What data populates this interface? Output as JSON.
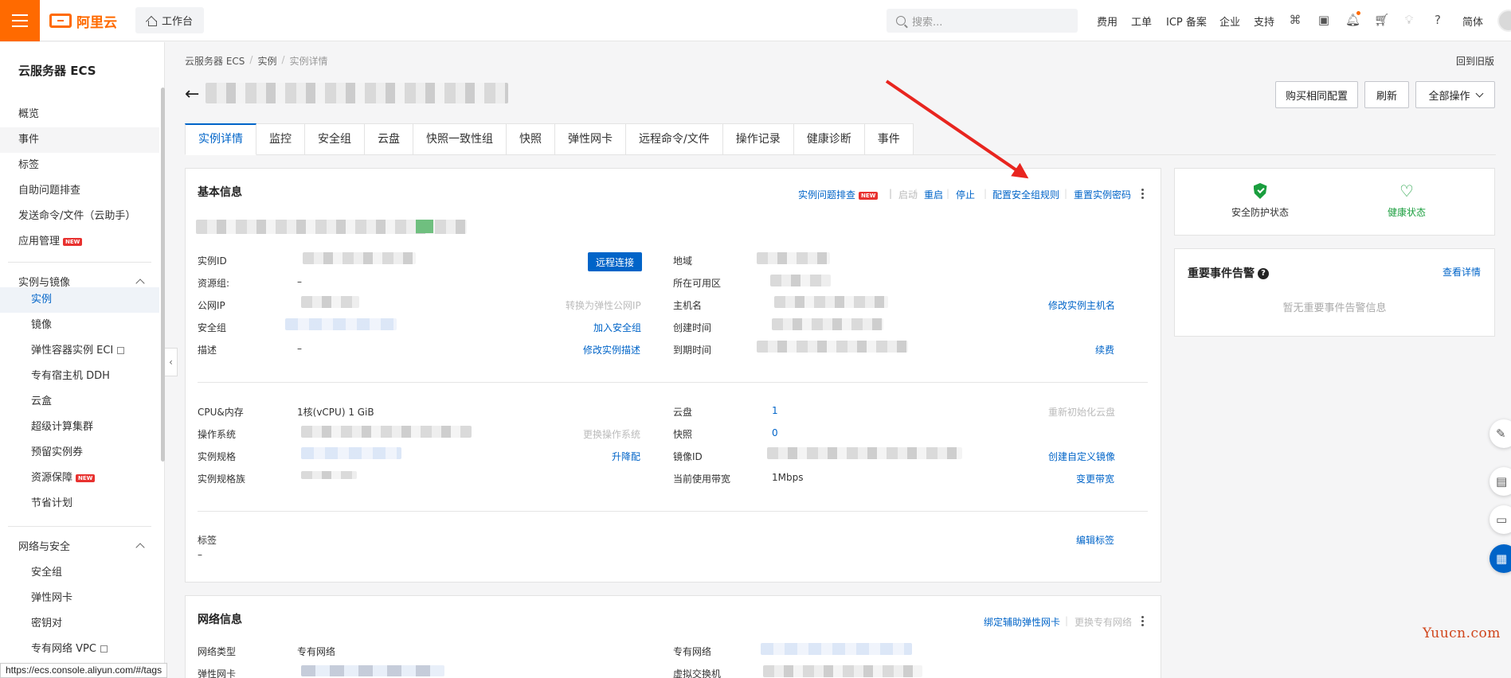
{
  "topbar": {
    "logo_text": "阿里云",
    "workbench": "工作台",
    "search_placeholder": "搜索...",
    "nav": [
      "费用",
      "工单",
      "ICP 备案",
      "企业",
      "支持"
    ],
    "language": "简体"
  },
  "sidebar": {
    "title": "云服务器 ECS",
    "top_items": [
      {
        "label": "概览"
      },
      {
        "label": "事件"
      },
      {
        "label": "标签"
      },
      {
        "label": "自助问题排查"
      },
      {
        "label": "发送命令/文件（云助手）"
      },
      {
        "label": "应用管理",
        "badge": "NEW"
      }
    ],
    "groups": [
      {
        "label": "实例与镜像",
        "items": [
          {
            "label": "实例",
            "active": true
          },
          {
            "label": "镜像"
          },
          {
            "label": "弹性容器实例 ECI",
            "external": true
          },
          {
            "label": "专有宿主机 DDH"
          },
          {
            "label": "云盒"
          },
          {
            "label": "超级计算集群"
          },
          {
            "label": "预留实例券"
          },
          {
            "label": "资源保障",
            "badge": "NEW"
          },
          {
            "label": "节省计划"
          }
        ]
      },
      {
        "label": "网络与安全",
        "items": [
          {
            "label": "安全组"
          },
          {
            "label": "弹性网卡"
          },
          {
            "label": "密钥对"
          },
          {
            "label": "专有网络 VPC",
            "external": true
          }
        ]
      }
    ]
  },
  "status_url": "https://ecs.console.aliyun.com/#/tags",
  "breadcrumb": [
    "云服务器 ECS",
    "实例",
    "实例详情"
  ],
  "back_to_old": "回到旧版",
  "header_buttons": {
    "buy_same": "购买相同配置",
    "refresh": "刷新",
    "all_actions": "全部操作"
  },
  "tabs": [
    "实例详情",
    "监控",
    "安全组",
    "云盘",
    "快照一致性组",
    "快照",
    "弹性网卡",
    "远程命令/文件",
    "操作记录",
    "健康诊断",
    "事件"
  ],
  "basic_info": {
    "title": "基本信息",
    "actions": {
      "troubleshoot": "实例问题排查",
      "troubleshoot_badge": "NEW",
      "start": "启动",
      "restart": "重启",
      "stop": "停止",
      "configure_sg": "配置安全组规则",
      "reset_password": "重置实例密码"
    },
    "left_rows": [
      {
        "label": "实例ID",
        "value": ""
      },
      {
        "label": "资源组:",
        "value": "–"
      },
      {
        "label": "公网IP",
        "value": ""
      },
      {
        "label": "安全组",
        "value": ""
      },
      {
        "label": "描述",
        "value": "–"
      }
    ],
    "left_actions": {
      "remote_connect": "远程连接",
      "convert_eip": "转换为弹性公网IP",
      "join_sg": "加入安全组",
      "edit_desc": "修改实例描述"
    },
    "right_rows": [
      {
        "label": "地域"
      },
      {
        "label": "所在可用区"
      },
      {
        "label": "主机名"
      },
      {
        "label": "创建时间"
      },
      {
        "label": "到期时间"
      }
    ],
    "right_actions": {
      "edit_hostname": "修改实例主机名",
      "renew": "续费"
    },
    "config_left": [
      {
        "label": "CPU&内存",
        "value": "1核(vCPU) 1 GiB"
      },
      {
        "label": "操作系统",
        "value": ""
      },
      {
        "label": "实例规格",
        "value": ""
      },
      {
        "label": "实例规格族",
        "value": ""
      }
    ],
    "config_left_actions": {
      "change_os": "更换操作系统",
      "upgrade": "升降配"
    },
    "config_right": [
      {
        "label": "云盘",
        "value": "1"
      },
      {
        "label": "快照",
        "value": "0"
      },
      {
        "label": "镜像ID",
        "value": ""
      },
      {
        "label": "当前使用带宽",
        "value": "1Mbps"
      }
    ],
    "config_right_actions": {
      "reinit_disk": "重新初始化云盘",
      "create_image": "创建自定义镜像",
      "change_bw": "变更带宽"
    },
    "tags_label": "标签",
    "tags_value": "–",
    "edit_tags": "编辑标签"
  },
  "status_panel": {
    "security": "安全防护状态",
    "health": "健康状态"
  },
  "events_panel": {
    "title": "重要事件告警",
    "view_details": "查看详情",
    "empty": "暂无重要事件告警信息"
  },
  "network_info": {
    "title": "网络信息",
    "bind_eni": "绑定辅助弹性网卡",
    "change_vpc": "更换专有网络",
    "rows": [
      {
        "label": "网络类型",
        "value": "专有网络"
      },
      {
        "label": "弹性网卡",
        "value": ""
      }
    ],
    "right_rows": [
      {
        "label": "专有网络"
      },
      {
        "label": "虚拟交换机"
      }
    ]
  },
  "watermark": "Yuucn.com",
  "colors": {
    "brand": "#ff6a00",
    "link": "#0064c8",
    "success": "#1a9e3e",
    "annotation": "#e8251f"
  }
}
